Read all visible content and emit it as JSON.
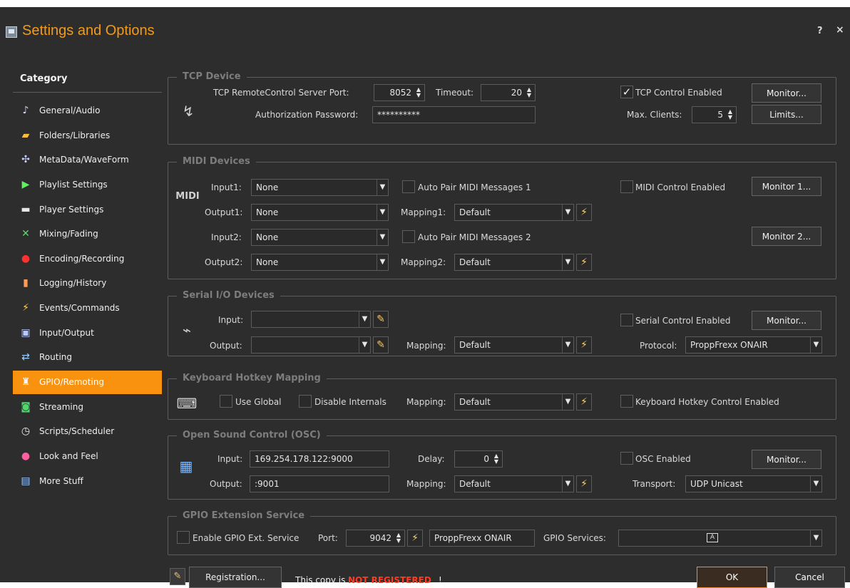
{
  "window": {
    "title": "Settings and Options",
    "help": "?",
    "close": "×"
  },
  "sidebar": {
    "title": "Category",
    "items": [
      {
        "label": "General/Audio",
        "icon": "music-note-icon"
      },
      {
        "label": "Folders/Libraries",
        "icon": "folder-icon"
      },
      {
        "label": "MetaData/WaveForm",
        "icon": "tools-icon"
      },
      {
        "label": "Playlist Settings",
        "icon": "playlist-icon"
      },
      {
        "label": "Player Settings",
        "icon": "player-icon"
      },
      {
        "label": "Mixing/Fading",
        "icon": "mixing-icon"
      },
      {
        "label": "Encoding/Recording",
        "icon": "record-icon"
      },
      {
        "label": "Logging/History",
        "icon": "book-icon"
      },
      {
        "label": "Events/Commands",
        "icon": "lightning-icon"
      },
      {
        "label": "Input/Output",
        "icon": "io-icon"
      },
      {
        "label": "Routing",
        "icon": "routing-icon"
      },
      {
        "label": "GPIO/Remoting",
        "icon": "trophy-icon"
      },
      {
        "label": "Streaming",
        "icon": "streaming-icon"
      },
      {
        "label": "Scripts/Scheduler",
        "icon": "clock-icon"
      },
      {
        "label": "Look and Feel",
        "icon": "palette-icon"
      },
      {
        "label": "More Stuff",
        "icon": "stuff-icon"
      }
    ]
  },
  "tcp": {
    "title": "TCP Device",
    "port_label": "TCP RemoteControl Server Port:",
    "port_value": "8052",
    "timeout_label": "Timeout:",
    "timeout_value": "20",
    "enabled_label": "TCP Control Enabled",
    "monitor_button": "Monitor...",
    "auth_label": "Authorization Password:",
    "auth_value": "**********",
    "max_clients_label": "Max. Clients:",
    "max_clients_value": "5",
    "limits_button": "Limits..."
  },
  "midi": {
    "title": "MIDI Devices",
    "input1_label": "Input1:",
    "input1_value": "None",
    "auto_pair1": "Auto Pair MIDI Messages 1",
    "enabled_label": "MIDI Control Enabled",
    "monitor1_button": "Monitor 1...",
    "output1_label": "Output1:",
    "output1_value": "None",
    "mapping1_label": "Mapping1:",
    "mapping1_value": "Default",
    "input2_label": "Input2:",
    "input2_value": "None",
    "auto_pair2": "Auto Pair MIDI Messages 2",
    "monitor2_button": "Monitor 2...",
    "output2_label": "Output2:",
    "output2_value": "None",
    "mapping2_label": "Mapping2:",
    "mapping2_value": "Default",
    "device_icon_text": "MIDI"
  },
  "serial": {
    "title": "Serial I/O Devices",
    "input_label": "Input:",
    "input_value": "",
    "output_label": "Output:",
    "output_value": "",
    "mapping_label": "Mapping:",
    "mapping_value": "Default",
    "enabled_label": "Serial Control Enabled",
    "monitor_button": "Monitor...",
    "protocol_label": "Protocol:",
    "protocol_value": "ProppFrexx ONAIR"
  },
  "keyboard": {
    "title": "Keyboard Hotkey Mapping",
    "use_global_label": "Use Global",
    "disable_internals_label": "Disable Internals",
    "mapping_label": "Mapping:",
    "mapping_value": "Default",
    "enabled_label": "Keyboard Hotkey Control Enabled"
  },
  "osc": {
    "title": "Open Sound Control (OSC)",
    "input_label": "Input:",
    "input_value": "169.254.178.122:9000",
    "delay_label": "Delay:",
    "delay_value": "0",
    "enabled_label": "OSC Enabled",
    "monitor_button": "Monitor...",
    "output_label": "Output:",
    "output_value": ":9001",
    "mapping_label": "Mapping:",
    "mapping_value": "Default",
    "transport_label": "Transport:",
    "transport_value": "UDP Unicast"
  },
  "gpio": {
    "title": "GPIO Extension Service",
    "enable_label": "Enable GPIO Ext. Service",
    "port_label": "Port:",
    "port_value": "9042",
    "service_name": "ProppFrexx ONAIR",
    "services_label": "GPIO Services:",
    "services_value": ""
  },
  "footer": {
    "registration_button": "Registration...",
    "copy_prefix": "This copy is",
    "not_registered": "NOT REGISTERED",
    "suffix": "!",
    "ok_button": "OK",
    "cancel_button": "Cancel"
  },
  "colors": {
    "accent": "#f8920f",
    "background": "#2d2d2d",
    "panel_border": "#5d5d5d",
    "warning": "#ff3b20"
  }
}
